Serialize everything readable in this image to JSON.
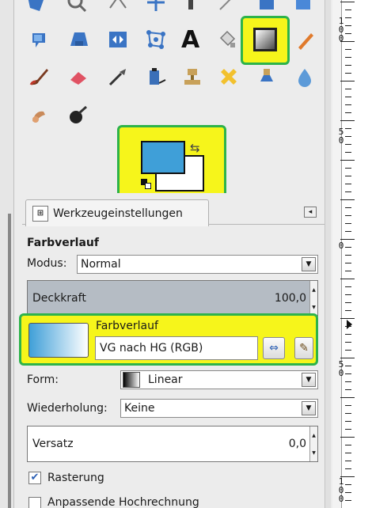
{
  "tool_options_tab": {
    "icon_text": "⊞",
    "label": "Werkzeugeinstellungen"
  },
  "tool_section": {
    "title": "Farbverlauf"
  },
  "mode": {
    "label": "Modus:",
    "value": "Normal"
  },
  "opacity": {
    "label": "Deckkraft",
    "value": "100,0",
    "fraction": 1.0
  },
  "gradient": {
    "label": "Farbverlauf",
    "value": "VG nach HG (RGB)"
  },
  "shape": {
    "label": "Form:",
    "value": "Linear"
  },
  "repeat": {
    "label": "Wiederholung:",
    "value": "Keine"
  },
  "offset": {
    "label": "Versatz",
    "value": "0,0",
    "fraction": 0.0
  },
  "dithering": {
    "label": "Rasterung",
    "checked": true
  },
  "adaptive": {
    "label": "Anpassende Hochrechnung",
    "checked": false
  },
  "ruler": {
    "labels": [
      [
        "1",
        "0",
        "0"
      ],
      [
        "5",
        "0"
      ],
      [
        "0"
      ],
      [
        "5",
        "0"
      ],
      [
        "1",
        "0",
        "0"
      ]
    ]
  },
  "colors": {
    "highlight": "#f6f51b",
    "highlight_border": "#2db34a",
    "foreground": "#3f9fd8",
    "background": "#ffffff"
  },
  "tools": [
    "free-select-icon",
    "fuzzy-select-icon",
    "paths-icon",
    "color-picker-icon",
    "zoom-icon",
    "measure-icon",
    "move-icon",
    "align-icon",
    "scale-icon",
    "shear-icon",
    "flip-icon",
    "cage-icon",
    "text-icon",
    "bucket-fill-icon",
    "blend-icon",
    "pencil-icon",
    "paintbrush-icon",
    "eraser-icon",
    "airbrush-icon",
    "ink-icon",
    "clone-icon",
    "heal-icon",
    "perspective-clone-icon",
    "smudge-icon",
    "blur-icon",
    "dodge-burn-icon"
  ]
}
